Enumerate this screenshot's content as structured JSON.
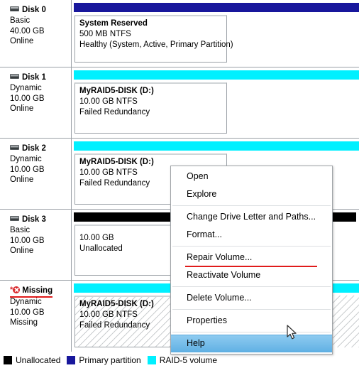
{
  "disks": [
    {
      "id": "disk-0",
      "name": "Disk 0",
      "type": "Basic",
      "size": "40.00 GB",
      "status": "Online",
      "missing": false,
      "bar_color": "#18179c",
      "bar_name": "primary-partition-capacity-bar",
      "volume": {
        "name": "System Reserved",
        "size": "500 MB NTFS",
        "status": "Healthy (System, Active, Primary Partition)",
        "hatched": false
      }
    },
    {
      "id": "disk-1",
      "name": "Disk 1",
      "type": "Dynamic",
      "size": "10.00 GB",
      "status": "Online",
      "missing": false,
      "bar_color": "#00f0ff",
      "bar_name": "raid5-volume-capacity-bar",
      "volume": {
        "name": "MyRAID5-DISK  (D:)",
        "size": "10.00 GB NTFS",
        "status": "Failed Redundancy",
        "hatched": false
      }
    },
    {
      "id": "disk-2",
      "name": "Disk 2",
      "type": "Dynamic",
      "size": "10.00 GB",
      "status": "Online",
      "missing": false,
      "bar_color": "#00f0ff",
      "bar_name": "raid5-volume-capacity-bar",
      "volume": {
        "name": "MyRAID5-DISK  (D:)",
        "size": "10.00 GB NTFS",
        "status": "Failed Redundancy",
        "hatched": false
      }
    },
    {
      "id": "disk-3",
      "name": "Disk 3",
      "type": "Basic",
      "size": "10.00 GB",
      "status": "Online",
      "missing": false,
      "bar_color": "#000000",
      "bar_name": "unallocated-capacity-bar",
      "volume": {
        "name": "",
        "size": "10.00 GB",
        "status": "Unallocated",
        "hatched": false
      }
    },
    {
      "id": "disk-missing",
      "name": "Missing",
      "type": "Dynamic",
      "size": "10.00 GB",
      "status": "Missing",
      "missing": true,
      "bar_color": "#00f0ff",
      "bar_name": "raid5-volume-capacity-bar",
      "volume": {
        "name": "MyRAID5-DISK  (D:)",
        "size": "10.00 GB NTFS",
        "status": "Failed Redundancy",
        "hatched": true
      }
    }
  ],
  "context_menu": {
    "items": [
      {
        "label": "Open",
        "separator_after": false,
        "selected": false,
        "highlighted_red": false
      },
      {
        "label": "Explore",
        "separator_after": true,
        "selected": false,
        "highlighted_red": false
      },
      {
        "label": "Change Drive Letter and Paths...",
        "separator_after": false,
        "selected": false,
        "highlighted_red": false
      },
      {
        "label": "Format...",
        "separator_after": true,
        "selected": false,
        "highlighted_red": false
      },
      {
        "label": "Repair Volume...",
        "separator_after": false,
        "selected": false,
        "highlighted_red": true
      },
      {
        "label": "Reactivate Volume",
        "separator_after": true,
        "selected": false,
        "highlighted_red": false
      },
      {
        "label": "Delete Volume...",
        "separator_after": true,
        "selected": false,
        "highlighted_red": false
      },
      {
        "label": "Properties",
        "separator_after": true,
        "selected": false,
        "highlighted_red": false
      },
      {
        "label": "Help",
        "separator_after": false,
        "selected": true,
        "highlighted_red": false
      }
    ]
  },
  "legend": [
    {
      "label": "Unallocated",
      "color": "#000000"
    },
    {
      "label": "Primary partition",
      "color": "#18179c"
    },
    {
      "label": "RAID-5 volume",
      "color": "#00f0ff"
    }
  ],
  "colors": {
    "raid5": "#00f0ff",
    "primary_partition": "#18179c",
    "unallocated": "#000000",
    "selection_blue": "#6fb9e8",
    "annotation_red": "#e01b1b",
    "missing_error": "#d8262a"
  }
}
